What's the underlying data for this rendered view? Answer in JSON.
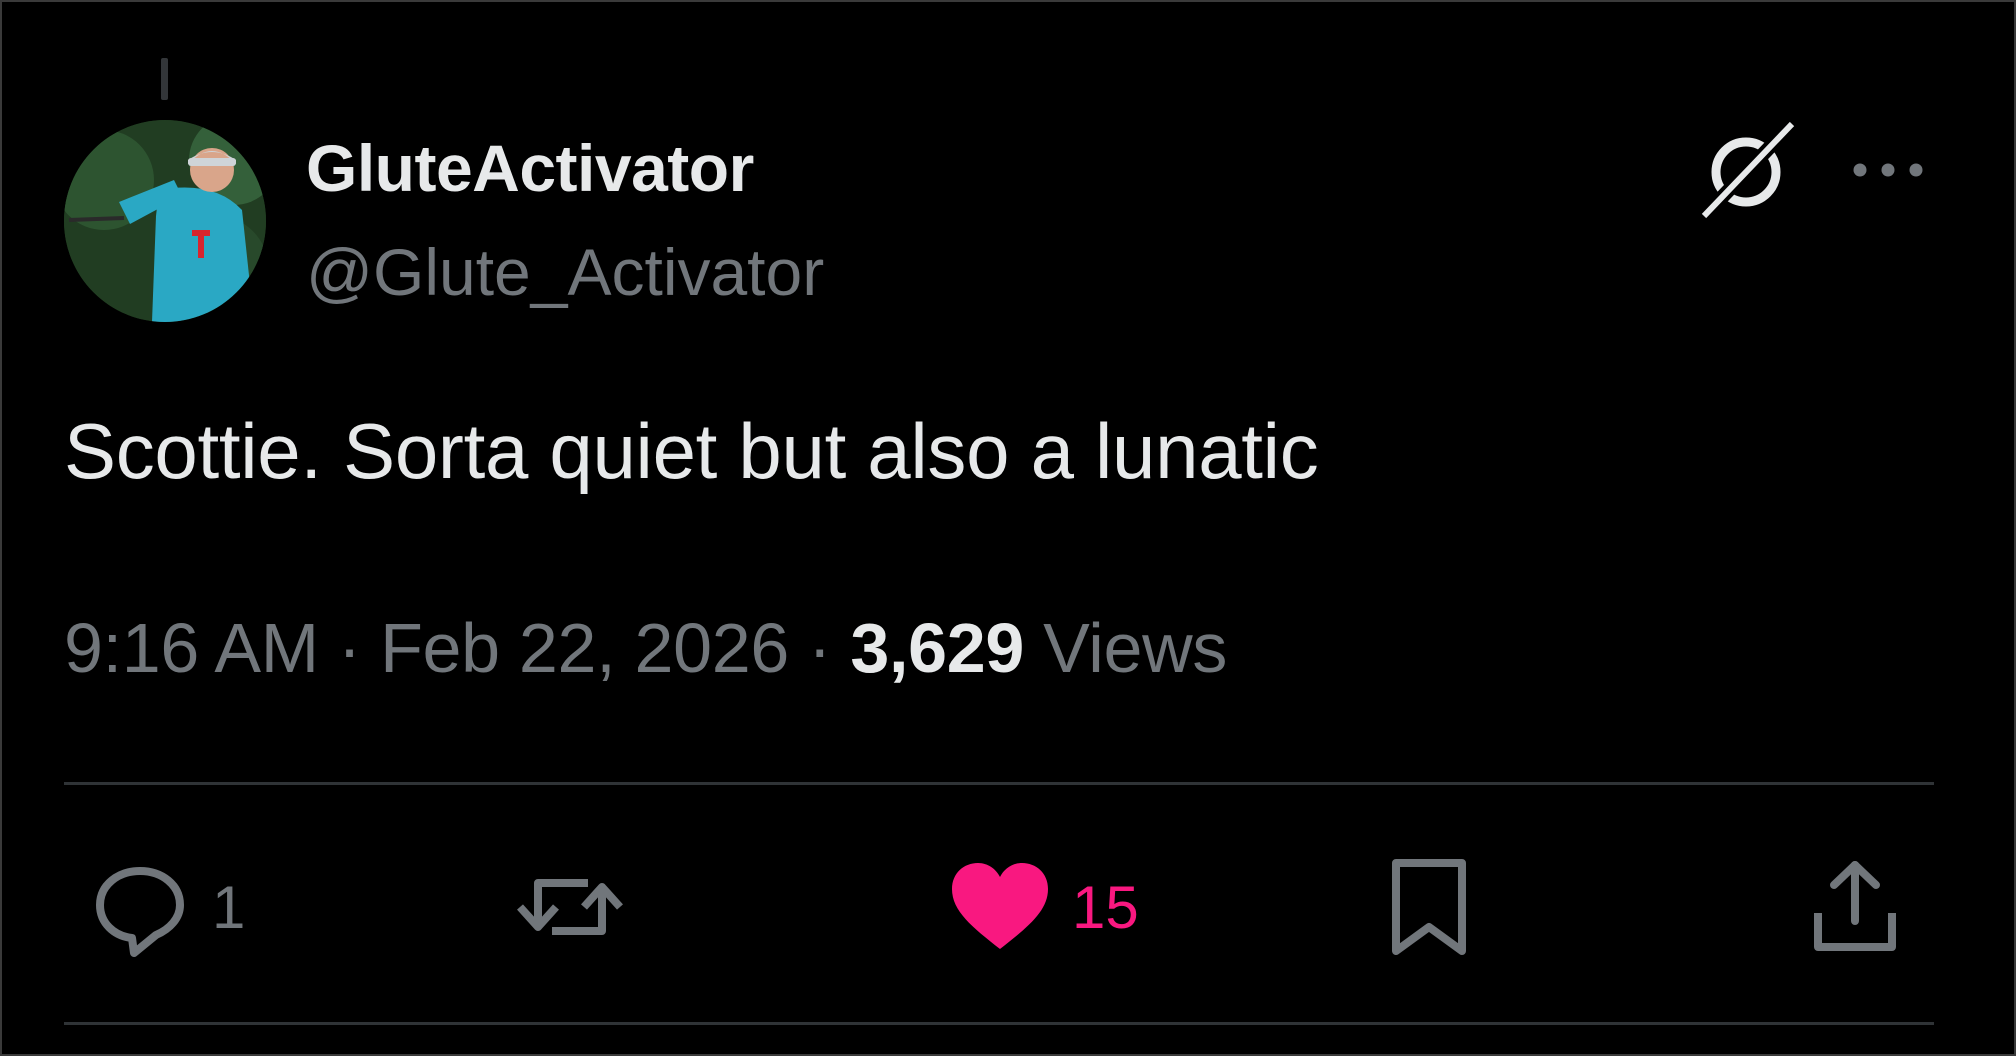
{
  "tweet": {
    "author": {
      "display_name": "GluteActivator",
      "handle": "@Glute_Activator"
    },
    "text": "Scottie. Sorta quiet but also a lunatic",
    "meta": {
      "time": "9:16 AM",
      "separator": "·",
      "date": "Feb 22, 2026",
      "views_count": "3,629",
      "views_label": "Views"
    },
    "actions": {
      "reply_count": "1",
      "repost_count": "",
      "like_count": "15",
      "liked": true
    }
  },
  "icons": {
    "grok": "grok-icon",
    "more": "more-icon",
    "reply": "reply-icon",
    "repost": "repost-icon",
    "like": "heart-icon",
    "bookmark": "bookmark-icon",
    "share": "share-icon"
  },
  "colors": {
    "background": "#000000",
    "primary_text": "#e7e9ea",
    "secondary_text": "#71767b",
    "divider": "#2f3336",
    "like": "#f91880"
  }
}
